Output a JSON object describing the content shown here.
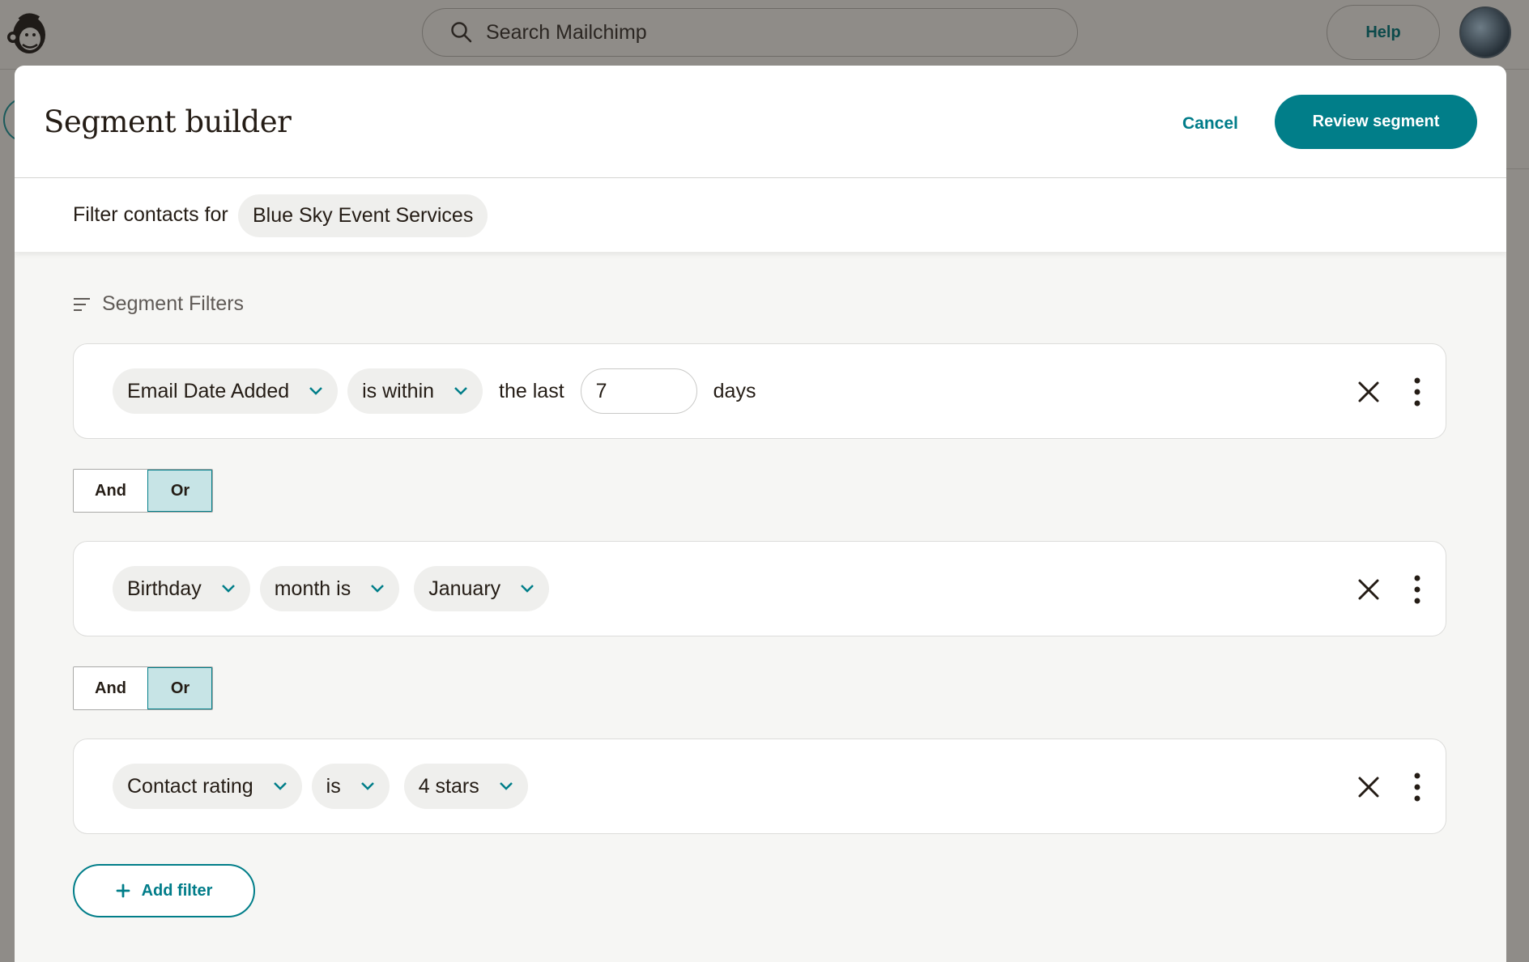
{
  "app": {
    "search_placeholder": "Search Mailchimp",
    "help_label": "Help"
  },
  "modal": {
    "title": "Segment builder",
    "cancel_label": "Cancel",
    "review_label": "Review segment",
    "filter_contacts_label": "Filter contacts for",
    "audience_name": "Blue Sky Event Services",
    "section_title": "Segment Filters"
  },
  "filters": [
    {
      "field": "Email Date Added",
      "operator": "is within",
      "text_before": "the last",
      "value": "7",
      "text_after": "days"
    },
    {
      "field": "Birthday",
      "operator": "month is",
      "value": "January"
    },
    {
      "field": "Contact rating",
      "operator": "is",
      "value": "4 stars"
    }
  ],
  "logic_toggles": [
    {
      "options": [
        "And",
        "Or"
      ],
      "selected": "Or"
    },
    {
      "options": [
        "And",
        "Or"
      ],
      "selected": "Or"
    }
  ],
  "add_filter_label": "Add filter",
  "colors": {
    "accent": "#017e89",
    "accent_light": "#c7e4e6",
    "overlay": "#8f8c88"
  },
  "icons": [
    "mailchimp-logo-icon",
    "search-icon",
    "chevron-down-icon",
    "close-icon",
    "more-vertical-icon",
    "filter-lines-icon",
    "plus-icon"
  ]
}
